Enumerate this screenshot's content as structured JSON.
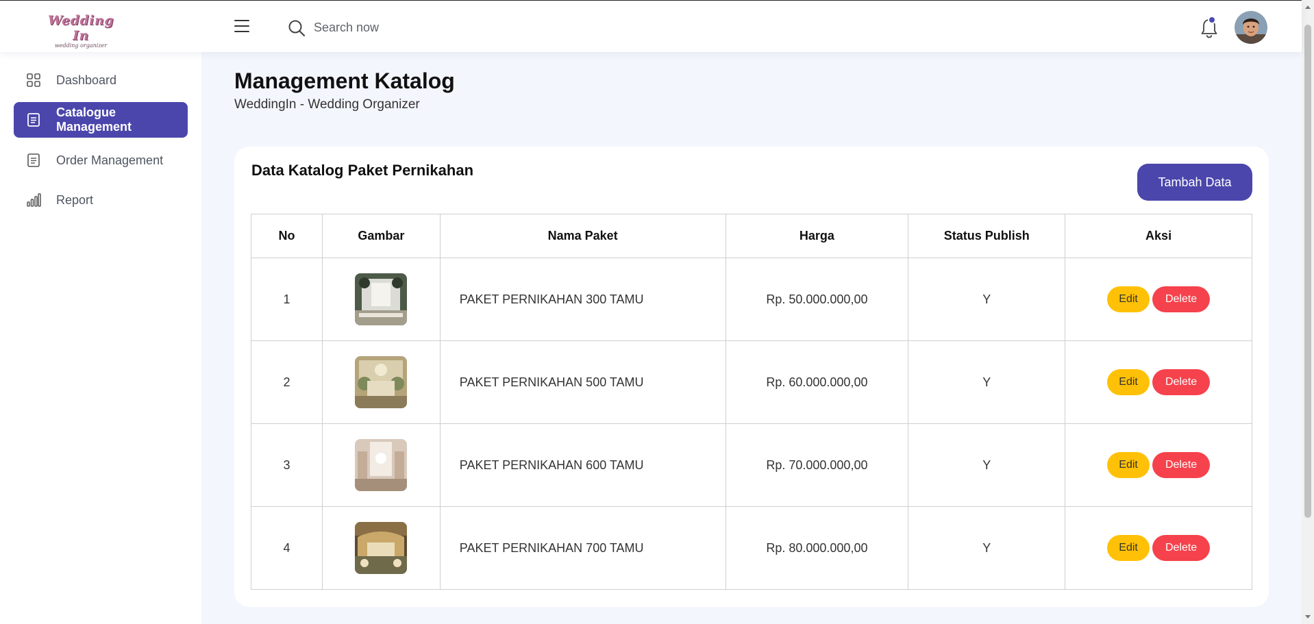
{
  "header": {
    "logo_title": "Wedding In",
    "logo_subtitle": "wedding organizer",
    "search_placeholder": "Search now",
    "icons": {
      "menu": "hamburger-icon",
      "search": "search-icon",
      "notifications": "bell-icon",
      "avatar": "user-avatar"
    },
    "notification_dot_color": "#4b4ab3"
  },
  "sidebar": {
    "items": [
      {
        "label": "Dashboard",
        "icon": "grid-icon",
        "active": false
      },
      {
        "label": "Catalogue Management",
        "icon": "document-icon",
        "active": true
      },
      {
        "label": "Order Management",
        "icon": "document-icon",
        "active": false
      },
      {
        "label": "Report",
        "icon": "bar-chart-icon",
        "active": false
      }
    ],
    "active_color": "#4b46ac"
  },
  "main": {
    "title": "Management Katalog",
    "subtitle": "WeddingIn - Wedding Organizer",
    "card": {
      "title": "Data Katalog Paket Pernikahan",
      "add_button_label": "Tambah Data",
      "columns": [
        "No",
        "Gambar",
        "Nama Paket",
        "Harga",
        "Status Publish",
        "Aksi"
      ],
      "rows": [
        {
          "no": "1",
          "name": "PAKET PERNIKAHAN 300 TAMU",
          "price": "Rp. 50.000.000,00",
          "status": "Y"
        },
        {
          "no": "2",
          "name": "PAKET PERNIKAHAN 500 TAMU",
          "price": "Rp. 60.000.000,00",
          "status": "Y"
        },
        {
          "no": "3",
          "name": "PAKET PERNIKAHAN 600 TAMU",
          "price": "Rp. 70.000.000,00",
          "status": "Y"
        },
        {
          "no": "4",
          "name": "PAKET PERNIKAHAN 700 TAMU",
          "price": "Rp. 80.000.000,00",
          "status": "Y"
        }
      ],
      "edit_label": "Edit",
      "delete_label": "Delete",
      "edit_color": "#ffc107",
      "delete_color": "#f5424c"
    }
  }
}
